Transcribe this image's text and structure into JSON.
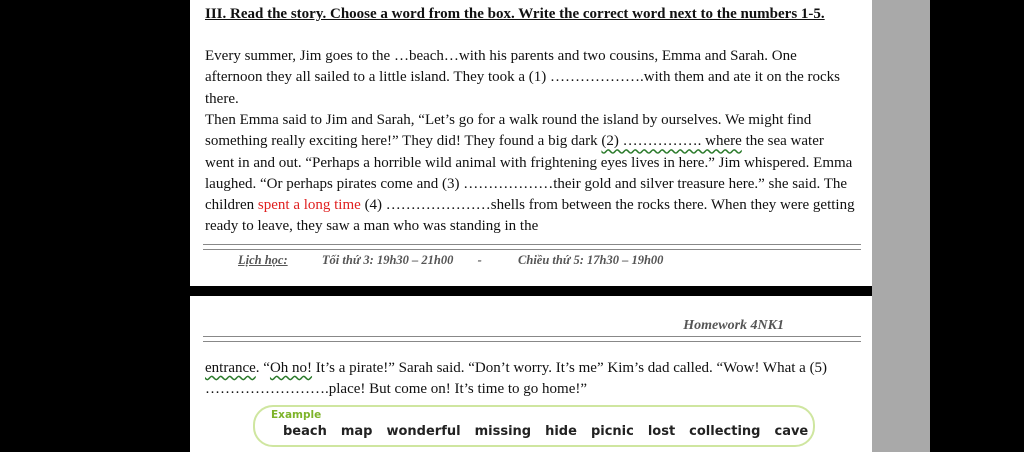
{
  "heading": "III. Read the story. Choose a word from the box. Write the correct word next to the numbers 1-5.",
  "para1": "Every summer, Jim goes to the …beach…with his parents and two cousins, Emma and Sarah. One afternoon they all sailed to a little island. They took a (1) ……………….with them and ate it on the rocks there.",
  "para2": {
    "a": "Then Emma said to Jim and Sarah, “Let’s go for a walk round the island by ourselves. We might find something really exciting here!” They did! They found a big dark ",
    "b": "(2) ……………. where",
    "c": " the sea water went in and out. “Perhaps a horrible wild animal with frightening eyes lives in here.” Jim whispered. Emma laughed. “Or perhaps pirates come and (3) ………………their gold and silver treasure here.” she said. The children ",
    "red": "spent a long time",
    "d": " (4) …………………shells from between the rocks there. When they were getting ready to leave, they saw a man who was standing in the"
  },
  "schedule": {
    "label": "Lịch học:",
    "slot1": "Tối thứ 3: 19h30 – 21h00",
    "sep": "-",
    "slot2": "Chiều thứ 5: 17h30 – 19h00"
  },
  "homework": "Homework 4NK1",
  "para3": {
    "a": "entrance",
    "b": ". “",
    "c": "Oh no!",
    "d": " It’s a pirate!” Sarah said. “Don’t worry. It’s me” Kim’s dad called. “Wow! What a (5) …………………….place! But come on! It’s time to go home!”"
  },
  "wordbox": {
    "label": "Example",
    "words": [
      "beach",
      "map",
      "wonderful",
      "missing",
      "hide",
      "picnic",
      "lost",
      "collecting",
      "cave"
    ]
  }
}
